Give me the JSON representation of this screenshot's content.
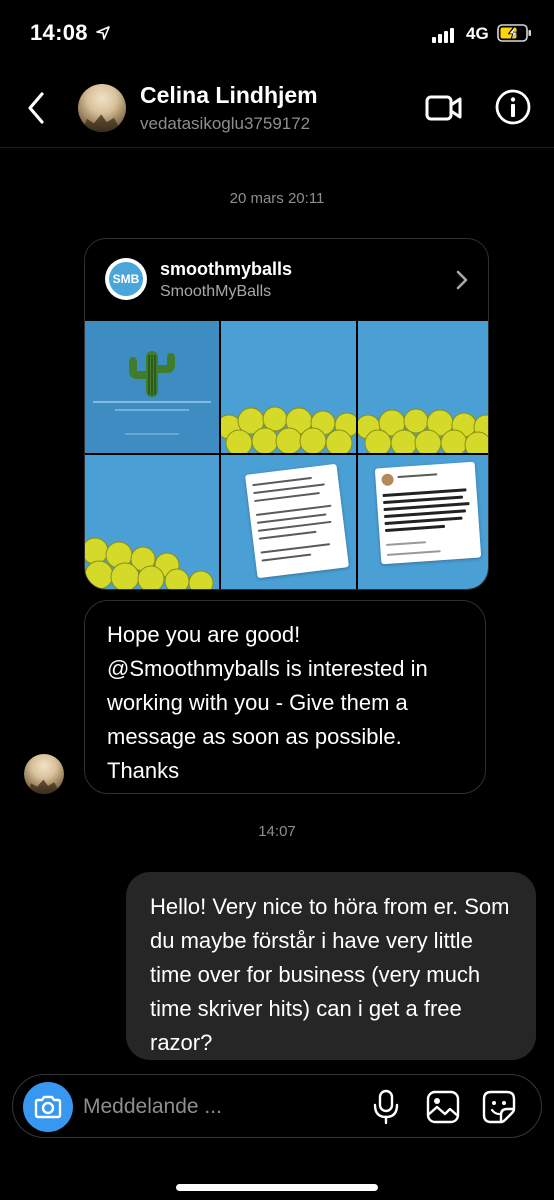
{
  "status_bar": {
    "time": "14:08",
    "network": "4G"
  },
  "header": {
    "contact_name": "Celina Lindhjem",
    "contact_username": "vedatasikoglu3759172"
  },
  "conversation": {
    "timestamp_1": "20 mars 20:11",
    "shared_post": {
      "logo_text": "SMB",
      "account_name": "smoothmyballs",
      "account_display": "SmoothMyBalls"
    },
    "received_message": "Hope you are good! @Smoothmyballs is interested in working with you - Give them a message as soon as possible. Thanks",
    "timestamp_2": "14:07",
    "sent_message": "Hello! Very nice to höra from er. Som du maybe förstår i have very little time over for business (very much time skriver hits) can i get a free razor?"
  },
  "composer": {
    "placeholder": "Meddelande ..."
  },
  "colors": {
    "background": "#000000",
    "accent": "#3897f0",
    "sent_bubble": "#262626",
    "secondary_text": "#8e8e8e"
  }
}
